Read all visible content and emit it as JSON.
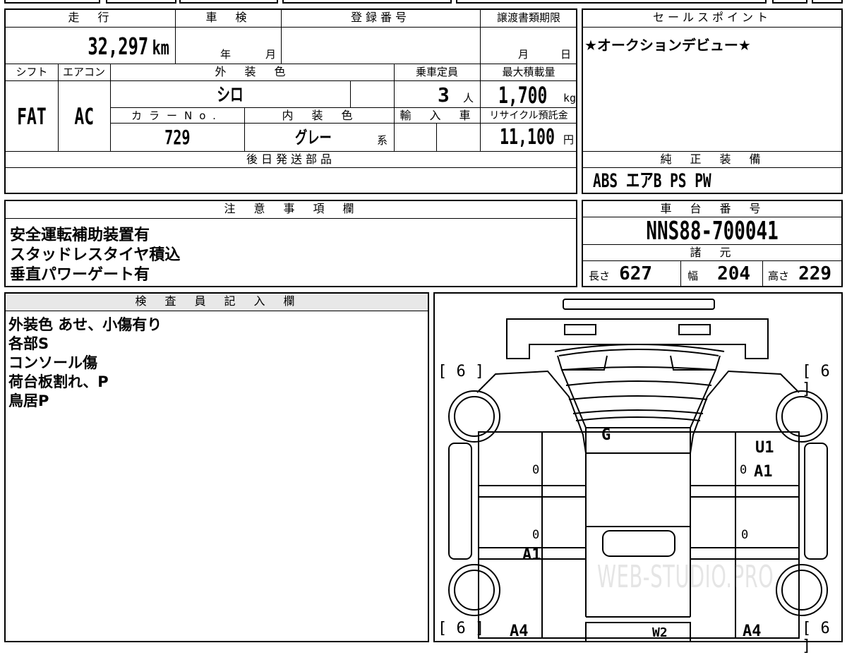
{
  "headers": {
    "mileage": "走　行",
    "inspection": "車　検",
    "registration": "登録番号",
    "transfer_deadline": "譲渡書類期限",
    "sales_point": "セールスポイント",
    "shift": "シフト",
    "aircon": "エアコン",
    "exterior_color": "外　装　色",
    "capacity": "乗車定員",
    "max_load": "最大積載量",
    "color_no": "カラーNo.",
    "interior_color": "内　装　色",
    "import": "輸　入　車",
    "recycle": "リサイクル預託金",
    "later_parts": "後日発送部品",
    "genuine_equipment": "純　正　装　備",
    "notes": "注　意　事　項　欄",
    "chassis_no": "車　台　番　号",
    "specs": "諸　元",
    "inspector": "検　査　員　記　入　欄"
  },
  "values": {
    "mileage": "32,297",
    "mileage_unit": "km",
    "year_unit": "年",
    "month_unit": "月",
    "deadline_month": "月",
    "deadline_day": "日",
    "shift": "FAT",
    "aircon": "AC",
    "exterior_color": "シロ",
    "capacity": "3",
    "capacity_unit": "人",
    "max_load": "1,700",
    "max_load_unit": "kg",
    "color_no": "729",
    "interior_color": "グレー",
    "interior_suffix": "系",
    "recycle": "11,100",
    "recycle_unit": "円",
    "sales_point": "★オークションデビュー★",
    "genuine_equipment": "ABS エアB PS PW",
    "chassis_no": "NNS88-700041",
    "length_label": "長さ",
    "length": "627",
    "width_label": "幅",
    "width": "204",
    "height_label": "高さ",
    "height": "229"
  },
  "notes_lines": [
    "安全運転補助装置有",
    "スタッドレスタイヤ積込",
    "垂直パワーゲート有"
  ],
  "inspector_lines": [
    "外装色 あせ、小傷有り",
    "各部S",
    "コンソール傷",
    "荷台板割れ、P",
    "鳥居P"
  ],
  "diagram": {
    "tire_label": "[ 6 ]",
    "marks": {
      "g": "G",
      "u1": "U1",
      "a1_right": "A1",
      "a1_left": "A1",
      "zero": "0",
      "a4_left": "A4",
      "a4_right": "A4",
      "w2": "W2"
    },
    "watermark": "WEB-STUDIO.PRO"
  }
}
